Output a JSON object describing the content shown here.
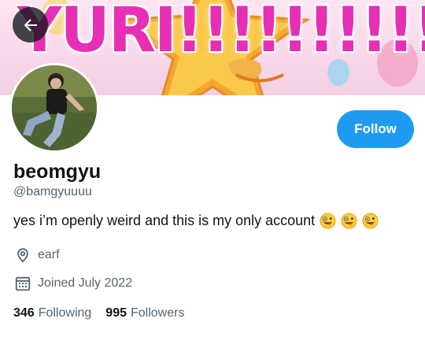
{
  "banner": {
    "text": "YURI!!!!!!!!!!!!!!"
  },
  "header": {
    "back_icon": "arrow-left-icon"
  },
  "profile": {
    "display_name": "beomgyu",
    "handle": "@bamgyuuuu",
    "bio": "yes i’m openly weird and this is my only account",
    "bio_emojis": [
      "zany-face-icon",
      "zany-face-icon",
      "zany-face-icon"
    ],
    "location": "earf",
    "joined": "Joined July 2022",
    "following_count": "346",
    "following_label": "Following",
    "followers_count": "995",
    "followers_label": "Followers"
  },
  "actions": {
    "follow_label": "Follow"
  },
  "colors": {
    "accent": "#1d9bf0",
    "banner_text": "#e62fb5",
    "muted": "#536471"
  }
}
